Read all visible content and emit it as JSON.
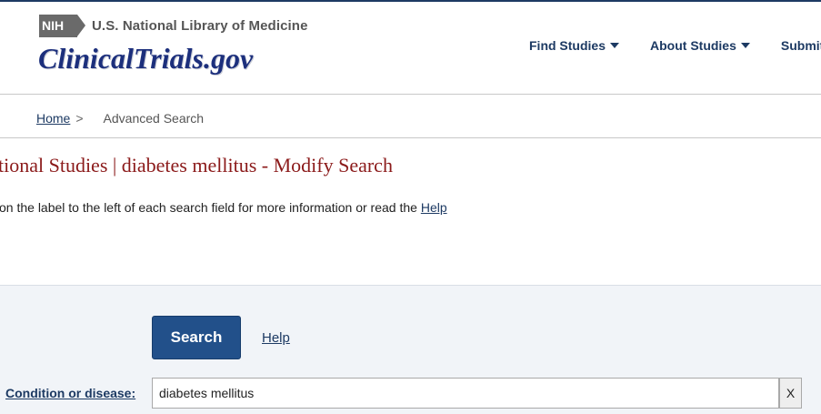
{
  "header": {
    "nih_badge": "NIH",
    "nlm_text": "U.S. National Library of Medicine",
    "brand": "ClinicalTrials.gov",
    "nav": [
      {
        "label": "Find Studies",
        "has_dropdown": true
      },
      {
        "label": "About Studies",
        "has_dropdown": true
      },
      {
        "label": "Submit",
        "has_dropdown": false
      }
    ]
  },
  "breadcrumb": {
    "home": "Home",
    "separator": ">",
    "current": "Advanced Search"
  },
  "main": {
    "title": "tional Studies | diabetes mellitus - Modify Search",
    "instruction_text": "on the label to the left of each search field for more information or read the ",
    "instruction_link": "Help"
  },
  "search_panel": {
    "search_button": "Search",
    "help_link": "Help",
    "condition_label": "Condition or disease:",
    "condition_value": "diabetes mellitus",
    "clear_button": "X"
  },
  "colors": {
    "brand_navy": "#1c2f7c",
    "nav_text": "#1d3a63",
    "title_red": "#8b1a1a",
    "search_button_bg": "#22508a",
    "panel_bg": "#f1f4f8"
  }
}
